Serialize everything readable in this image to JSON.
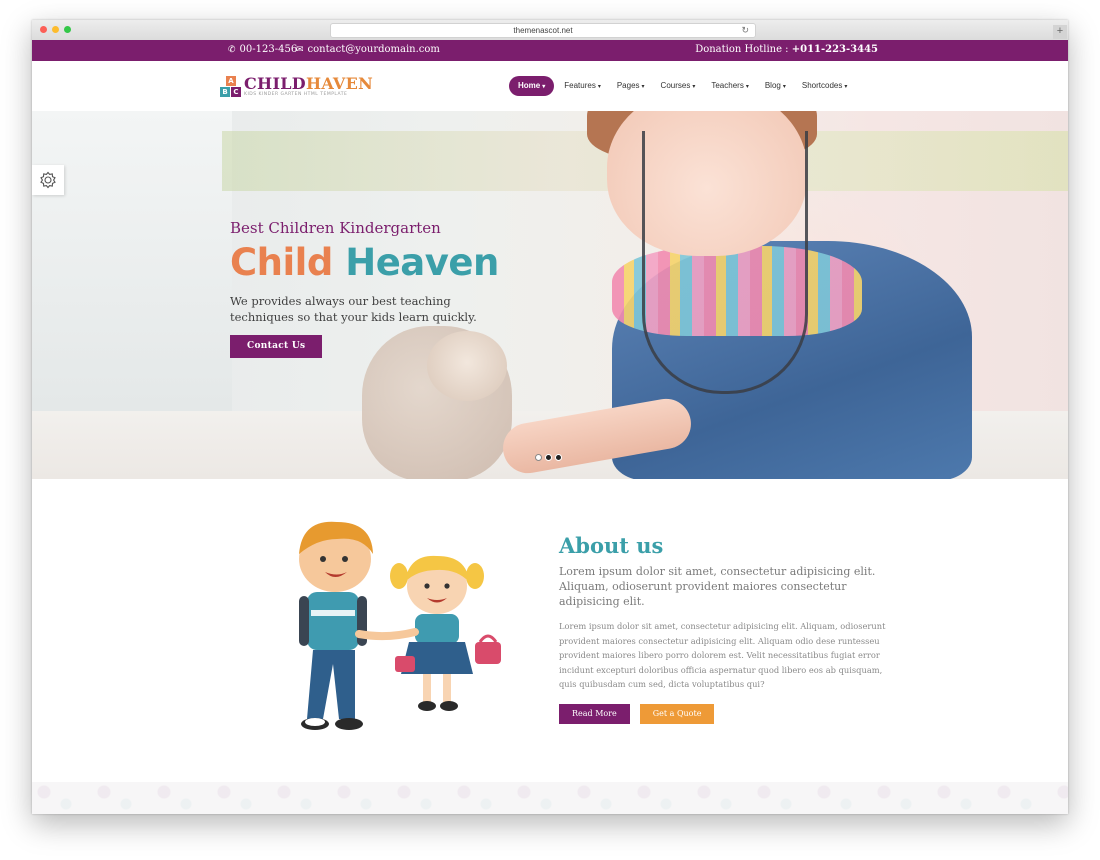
{
  "browser": {
    "url": "themenascot.net",
    "reload_icon": "reload-icon",
    "new_tab_label": "+"
  },
  "topbar": {
    "phone": "00-123-456",
    "email": "contact@yourdomain.com",
    "hotline_label": "Donation Hotline :",
    "hotline_number": "+011-223-3445",
    "phone_icon": "phone-icon",
    "email_icon": "envelope-icon"
  },
  "logo": {
    "blocks": [
      "A",
      "B",
      "C"
    ],
    "word_part1": "CHILD",
    "word_part2": "HAVEN",
    "tagline": "KIDS KINDER GARTEN HTML TEMPLATE"
  },
  "menu": [
    {
      "label": "Home",
      "active": true
    },
    {
      "label": "Features"
    },
    {
      "label": "Pages"
    },
    {
      "label": "Courses"
    },
    {
      "label": "Teachers"
    },
    {
      "label": "Blog"
    },
    {
      "label": "Shortcodes"
    }
  ],
  "hero": {
    "subtitle": "Best Children Kindergarten",
    "title_part1": "Child",
    "title_part2": "Heaven",
    "text": "We provides always our best teaching techniques so that your kids learn quickly.",
    "button": "Contact Us",
    "slides": 3,
    "active_slide": 1
  },
  "about": {
    "title": "About us",
    "lead": "Lorem ipsum dolor sit amet, consectetur adipisicing elit. Aliquam, odioserunt provident maiores consectetur adipisicing elit.",
    "body": "Lorem ipsum dolor sit amet, consectetur adipisicing elit. Aliquam, odioserunt provident maiores consectetur adipisicing elit. Aliquam odio dese runtesseu provident maiores libero porro dolorem est. Velit necessitatibus fugiat error incidunt excepturi doloribus officia aspernatur quod libero eos ab quisquam, quis quibusdam cum sed, dicta voluptatibus qui?",
    "read_more": "Read More",
    "get_quote": "Get a Quote"
  },
  "colors": {
    "brand_purple": "#7b1e6d",
    "teal": "#3b9fa9",
    "orange": "#e9814f",
    "button_orange": "#ee9a37"
  }
}
